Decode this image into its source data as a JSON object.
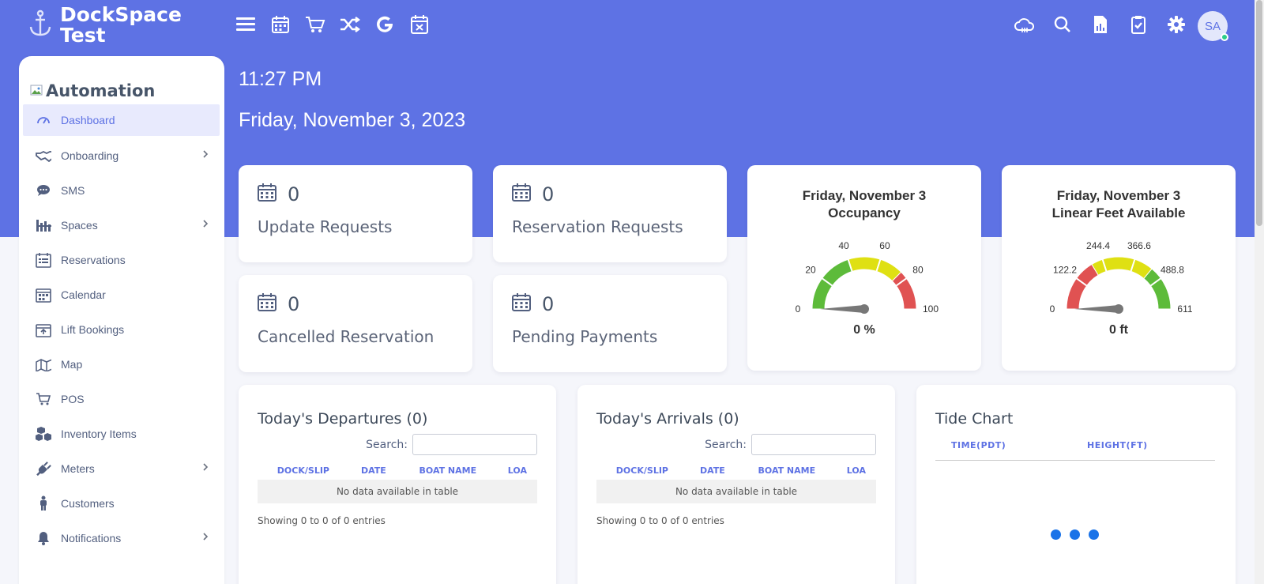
{
  "brand": {
    "name": "DockSpace Test",
    "icon": "anchor-icon"
  },
  "topbar": {
    "icons": [
      "menu-icon",
      "calendar-icon",
      "cart-icon",
      "shuffle-icon",
      "google-icon",
      "calendar-x-icon"
    ],
    "right_icons": [
      "cloud-icon",
      "search-icon",
      "file-chart-icon",
      "clipboard-check-icon",
      "gear-icon"
    ],
    "avatar": "SA"
  },
  "sidebar": {
    "title": "Automation",
    "items": [
      {
        "label": "Dashboard",
        "icon": "dashboard-icon",
        "active": true
      },
      {
        "label": "Onboarding",
        "icon": "handshake-icon",
        "chevron": true
      },
      {
        "label": "SMS",
        "icon": "chat-icon"
      },
      {
        "label": "Spaces",
        "icon": "spaces-icon",
        "chevron": true
      },
      {
        "label": "Reservations",
        "icon": "reservations-icon"
      },
      {
        "label": "Calendar",
        "icon": "calendar-icon"
      },
      {
        "label": "Lift Bookings",
        "icon": "lift-icon"
      },
      {
        "label": "Map",
        "icon": "map-icon"
      },
      {
        "label": "POS",
        "icon": "cart-icon"
      },
      {
        "label": "Inventory Items",
        "icon": "boxes-icon"
      },
      {
        "label": "Meters",
        "icon": "plug-icon",
        "chevron": true
      },
      {
        "label": "Customers",
        "icon": "person-icon"
      },
      {
        "label": "Notifications",
        "icon": "bell-icon",
        "chevron": true
      }
    ]
  },
  "header": {
    "time": "11:27 PM",
    "date": "Friday, November 3, 2023"
  },
  "stats": [
    {
      "value": "0",
      "label": "Update Requests"
    },
    {
      "value": "0",
      "label": "Reservation Requests"
    },
    {
      "value": "0",
      "label": "Cancelled Reservation"
    },
    {
      "value": "0",
      "label": "Pending Payments"
    }
  ],
  "gauges": [
    {
      "title_line1": "Friday, November 3",
      "title_line2": "Occupancy",
      "ticks": [
        "0",
        "20",
        "40",
        "60",
        "80",
        "100"
      ],
      "min": 0,
      "max": 100,
      "value": 0,
      "readout": "0 %",
      "bands": [
        {
          "from": 0,
          "to": 40,
          "color": "#5dbb3a"
        },
        {
          "from": 40,
          "to": 75,
          "color": "#dfe013"
        },
        {
          "from": 75,
          "to": 100,
          "color": "#e05252"
        }
      ]
    },
    {
      "title_line1": "Friday, November 3",
      "title_line2": "Linear Feet Available",
      "ticks": [
        "0",
        "122.2",
        "244.4",
        "366.6",
        "488.8",
        "611"
      ],
      "min": 0,
      "max": 611,
      "value": 0,
      "readout": "0 ft",
      "bands": [
        {
          "from": 0,
          "to": 200,
          "color": "#e05252"
        },
        {
          "from": 200,
          "to": 440,
          "color": "#dfe013"
        },
        {
          "from": 440,
          "to": 611,
          "color": "#5dbb3a"
        }
      ]
    }
  ],
  "departures": {
    "title": "Today's Departures (0)",
    "search_label": "Search:",
    "columns": [
      "DOCK/SLIP",
      "DATE",
      "BOAT NAME",
      "LOA"
    ],
    "empty": "No data available in table",
    "showing": "Showing 0 to 0 of 0 entries"
  },
  "arrivals": {
    "title": "Today's Arrivals (0)",
    "search_label": "Search:",
    "columns": [
      "DOCK/SLIP",
      "DATE",
      "BOAT NAME",
      "LOA"
    ],
    "empty": "No data available in table",
    "showing": "Showing 0 to 0 of 0 entries"
  },
  "tide": {
    "title": "Tide Chart",
    "col_time": "TIME(PDT)",
    "col_height": "HEIGHT(FT)"
  },
  "colors": {
    "primary": "#5e72e4",
    "loader": "#1a73e8"
  }
}
